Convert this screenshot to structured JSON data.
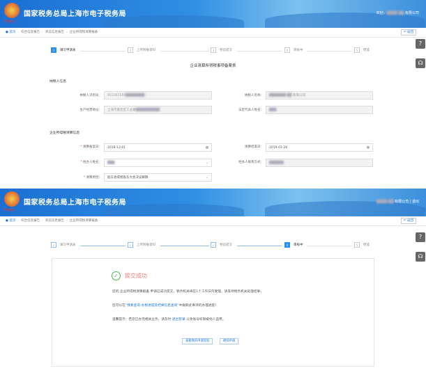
{
  "header": {
    "title": "国家税务总局上海市电子税务局",
    "emblem_text": "中国税务",
    "welcome": "欢迎，",
    "company": "有限公司",
    "logout": "退出"
  },
  "breadcrumb": [
    "首页",
    "综合信息报告",
    "状态信息报告",
    "企业所得税清算报备"
  ],
  "back_label": "返回",
  "steps": [
    {
      "num": "1",
      "label": "填写申请表"
    },
    {
      "num": "2",
      "label": "上传附报资料"
    },
    {
      "num": "3",
      "label": "预览提交"
    },
    {
      "num": "4",
      "label": "审核中"
    },
    {
      "num": "5",
      "label": "完成"
    }
  ],
  "form": {
    "title": "企业清算所得税事项备案表",
    "section1": "纳税人信息",
    "taxpayer_id_label": "纳税人识别号：",
    "taxpayer_id": "913101140",
    "taxpayer_name_label": "纳税人名称：",
    "taxpayer_name": "有限公司",
    "address_label": "生产经营地址：",
    "address": "上海市嘉定区工业路",
    "legal_rep_label": "法定代表人姓名：",
    "section2": "企业所得税清算信息",
    "start_label": "清算备案日：",
    "start_date": "2018-12-01",
    "end_label": "清算结束日：",
    "end_date": "2019-01-28",
    "agent_label": "经办人姓名：",
    "contact_label": "经办人联系方式：",
    "reason_label": "清算原因：",
    "reason": "股东会或者股东大会决议解散"
  },
  "result": {
    "title": "提交成功",
    "line1": "您的 企业所得税清算报备 申请已成功提交，税务机关将在1个工作日内受理，请等待税务机关处理结果。",
    "line2_pre": "您可以在",
    "line2_link": "“我要查询-办税进度及结果信息查询”",
    "line2_post": "中跟踪此事项的办理进度！",
    "line3_pre": "温馨提示：若您已办完相关业务，请及时 ",
    "line3_link": "退出登录",
    "line3_post": " 以免账号权限被他人盗用。",
    "btn_view": "查看我的申请资料",
    "btn_continue": "继续申请"
  }
}
